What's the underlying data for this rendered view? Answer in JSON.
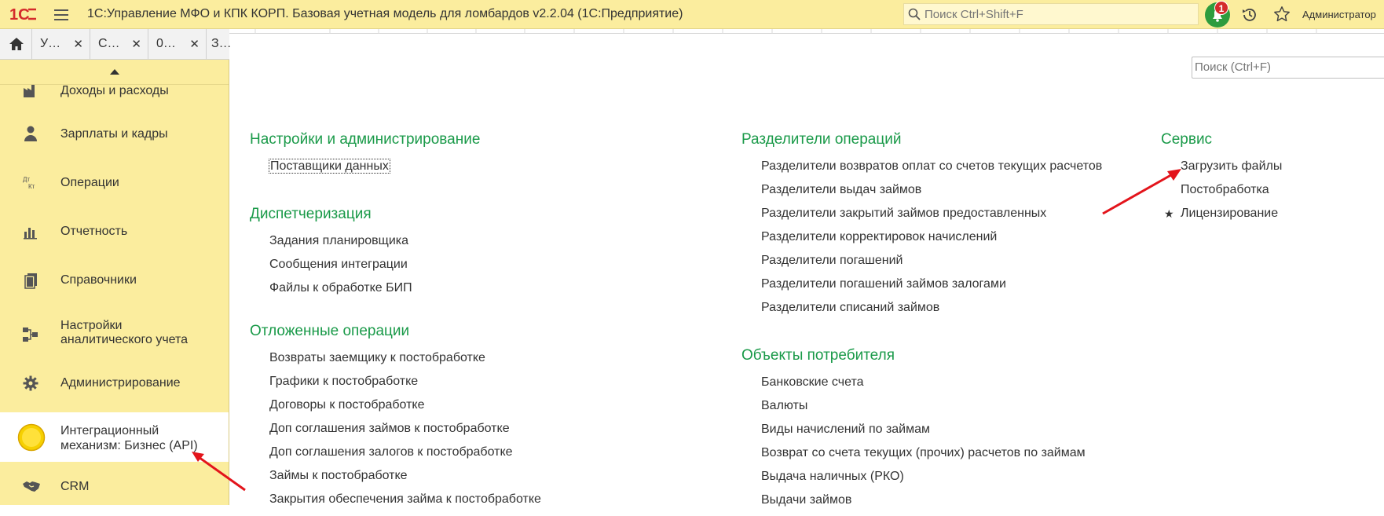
{
  "titlebar": {
    "app_title": "1С:Управление МФО и КПК КОРП. Базовая учетная модель для ломбардов v2.2.04  (1С:Предприятие)",
    "search_placeholder": "Поиск Ctrl+Shift+F",
    "notification_count": "1",
    "user_name": "Администратор",
    "brand_color": "#d42b2b"
  },
  "tabs": [
    {
      "label": "У…",
      "close": "✕"
    },
    {
      "label": "С…",
      "close": "✕"
    },
    {
      "label": "0…",
      "close": "✕"
    },
    {
      "label": "З…",
      "close": ""
    }
  ],
  "sidebar": {
    "items": [
      {
        "label": "Доходы и расходы",
        "icon": "factory-icon"
      },
      {
        "label": "Зарплаты и кадры",
        "icon": "person-icon"
      },
      {
        "label": "Операции",
        "icon": "dt-kt-icon"
      },
      {
        "label": "Отчетность",
        "icon": "bar-chart-icon"
      },
      {
        "label": "Справочники",
        "icon": "books-icon"
      },
      {
        "label": "Настройки\nаналитического учета",
        "line1": "Настройки",
        "line2": "аналитического учета",
        "icon": "hierarchy-icon"
      },
      {
        "label": "Администрирование",
        "icon": "gear-icon"
      },
      {
        "label": "Интеграционный механизм: Бизнес (API)",
        "line1": "Интеграционный",
        "line2": "механизм: Бизнес (API)",
        "icon": "yellow-circle-icon",
        "active": true
      },
      {
        "label": "CRM",
        "icon": "handshake-icon"
      }
    ]
  },
  "main": {
    "search_placeholder": "Поиск (Ctrl+F)",
    "accent_color": "#1a9a49",
    "groups": [
      {
        "title": "Настройки и администрирование",
        "links": [
          "Поставщики данных"
        ]
      },
      {
        "title": "Диспетчеризация",
        "links": [
          "Задания планировщика",
          "Сообщения интеграции",
          "Файлы к обработке БИП"
        ]
      },
      {
        "title": "Отложенные операции",
        "links": [
          "Возвраты заемщику к постобработке",
          "Графики к постобработке",
          "Договоры к постобработке",
          "Доп соглашения займов к постобработке",
          "Доп соглашения залогов к постобработке",
          "Займы к постобработке",
          "Закрытия обеспечения займа к постобработке"
        ]
      },
      {
        "title": "Разделители операций",
        "links": [
          "Разделители возвратов оплат со счетов текущих расчетов",
          "Разделители выдач займов",
          "Разделители закрытий займов предоставленных",
          "Разделители корректировок начислений",
          "Разделители погашений",
          "Разделители погашений займов залогами",
          "Разделители списаний займов"
        ]
      },
      {
        "title": "Объекты потребителя",
        "links": [
          "Банковские счета",
          "Валюты",
          "Виды начислений по займам",
          "Возврат со счета текущих (прочих) расчетов по займам",
          "Выдача наличных (РКО)",
          "Выдачи займов"
        ]
      },
      {
        "title": "Сервис",
        "links": [
          "Загрузить файлы",
          "Постобработка",
          "Лицензирование"
        ]
      }
    ]
  }
}
